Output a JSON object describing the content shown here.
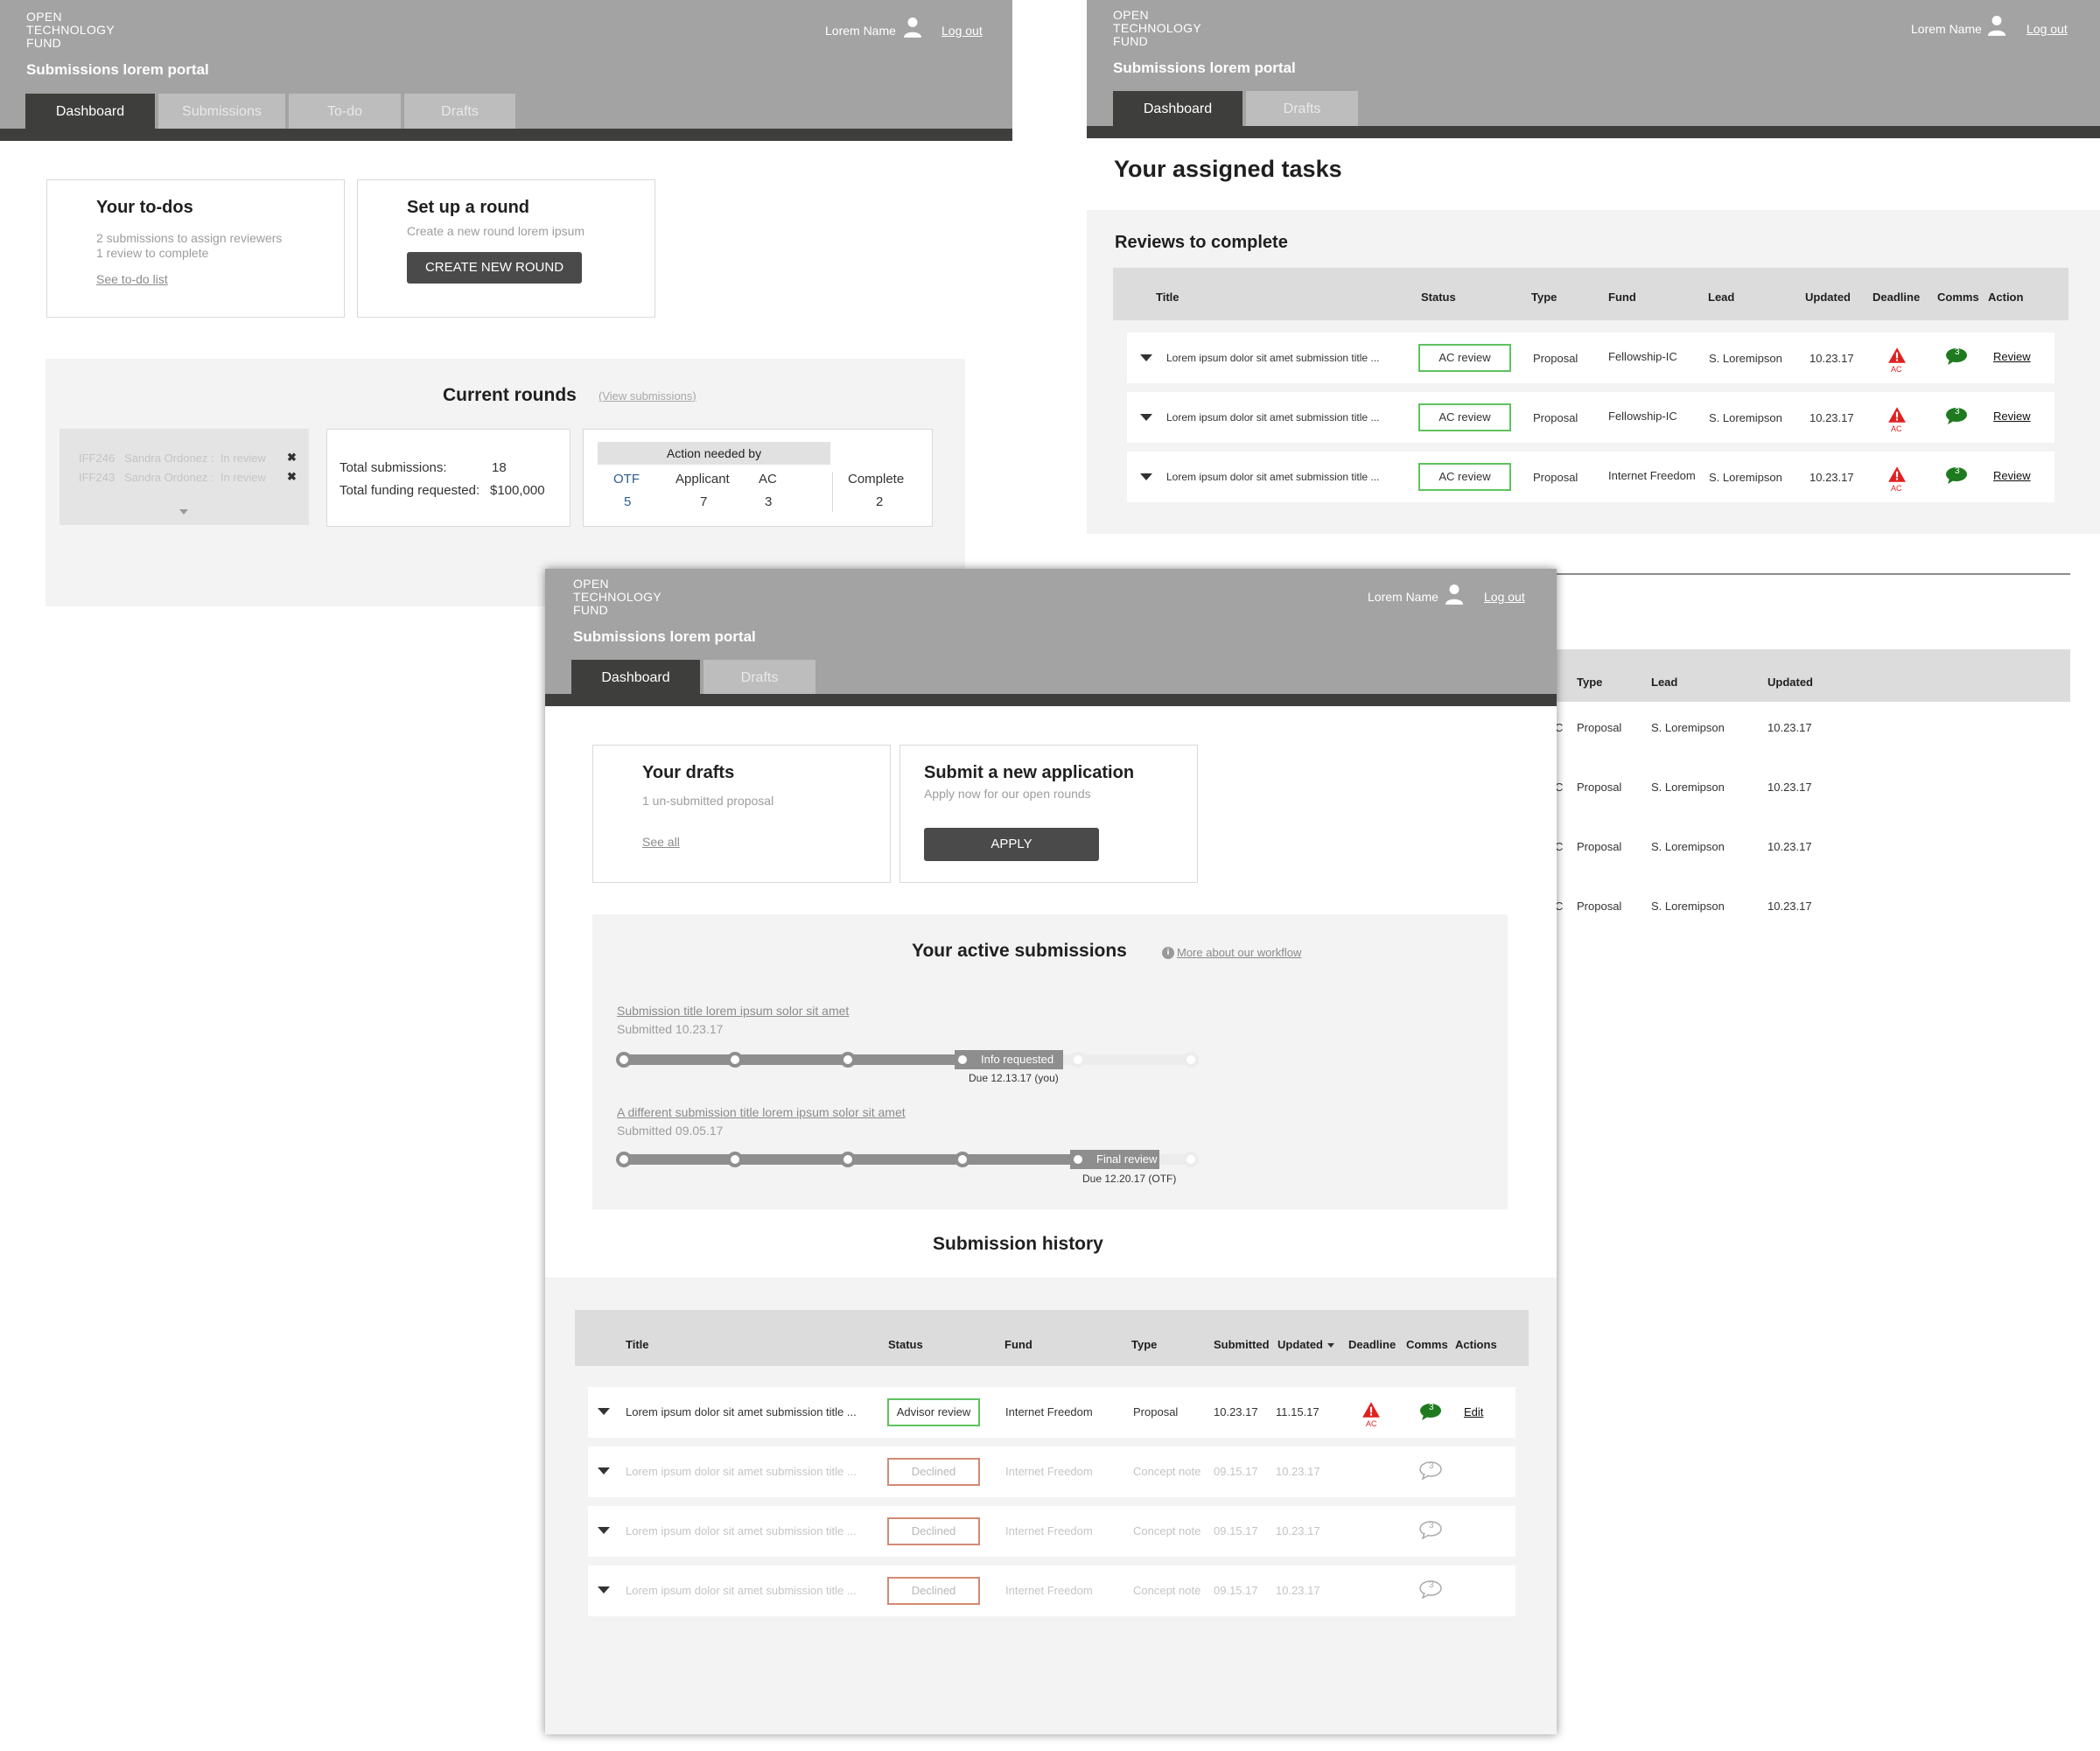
{
  "org_logo": [
    "OPEN",
    "TECHNOLOGY",
    "FUND"
  ],
  "portal_title": "Submissions lorem portal",
  "user_name": "Lorem Name",
  "logout_label": "Log out",
  "admin": {
    "tabs": [
      "Dashboard",
      "Submissions",
      "To-do",
      "Drafts"
    ],
    "todos": {
      "title": "Your to-dos",
      "line1": "2 submissions to assign reviewers",
      "line2": "1 review to complete",
      "link": "See to-do list"
    },
    "round": {
      "title": "Set up a round",
      "subtitle": "Create a new round lorem ipsum",
      "button": "CREATE NEW ROUND"
    },
    "current_rounds": {
      "title": "Current rounds",
      "view_link": "(View submissions)",
      "items": [
        {
          "id": "IFF246",
          "name": "Sandra Ordonez",
          "status": "In review"
        },
        {
          "id": "IFF243",
          "name": "Sandra Ordonez",
          "status": "In review"
        }
      ],
      "total_label": "Total submissions:",
      "total_value": "18",
      "funding_label": "Total funding requested:",
      "funding_value": "$100,000",
      "action_header": "Action needed by",
      "cols": [
        {
          "label": "OTF",
          "value": "5"
        },
        {
          "label": "Applicant",
          "value": "7"
        },
        {
          "label": "AC",
          "value": "3"
        }
      ],
      "complete_label": "Complete",
      "complete_value": "2"
    }
  },
  "reviewer": {
    "tabs": [
      "Dashboard",
      "Drafts"
    ],
    "page_title": "Your assigned tasks",
    "section_title": "Reviews to complete",
    "columns": [
      "Title",
      "Status",
      "Type",
      "Fund",
      "Lead",
      "Updated",
      "Deadline",
      "Comms",
      "Action"
    ],
    "rows": [
      {
        "title": "Lorem ipsum dolor sit amet submission title ...",
        "status": "AC review",
        "type": "Proposal",
        "fund": "Fellowship-IC",
        "lead": "S. Loremipson",
        "updated": "10.23.17",
        "deadline": "AC",
        "comms": "3",
        "action": "Review"
      },
      {
        "title": "Lorem ipsum dolor sit amet submission title ...",
        "status": "AC review",
        "type": "Proposal",
        "fund": "Fellowship-IC",
        "lead": "S. Loremipson",
        "updated": "10.23.17",
        "deadline": "AC",
        "comms": "3",
        "action": "Review"
      },
      {
        "title": "Lorem ipsum dolor sit amet submission title ...",
        "status": "AC review",
        "type": "Proposal",
        "fund": "Internet Freedom",
        "lead": "S. Loremipson",
        "updated": "10.23.17",
        "deadline": "AC",
        "comms": "3",
        "action": "Review"
      }
    ],
    "partial_columns": [
      "Type",
      "Lead",
      "Updated"
    ],
    "partial_rows": [
      {
        "prefix": "C",
        "type": "Proposal",
        "lead": "S. Loremipson",
        "updated": "10.23.17"
      },
      {
        "prefix": "C",
        "type": "Proposal",
        "lead": "S. Loremipson",
        "updated": "10.23.17"
      },
      {
        "prefix": "C",
        "type": "Proposal",
        "lead": "S. Loremipson",
        "updated": "10.23.17"
      },
      {
        "prefix": "C",
        "type": "Proposal",
        "lead": "S. Loremipson",
        "updated": "10.23.17"
      }
    ]
  },
  "applicant": {
    "tabs": [
      "Dashboard",
      "Drafts"
    ],
    "drafts": {
      "title": "Your drafts",
      "line": "1 un-submitted proposal",
      "link": "See all"
    },
    "apply": {
      "title": "Submit a new application",
      "subtitle": "Apply now for our open rounds",
      "button": "APPLY"
    },
    "active": {
      "title": "Your active submissions",
      "more_link": "More about our workflow",
      "submissions": [
        {
          "title": "Submission title lorem ipsum solor sit amet",
          "submitted": "Submitted 10.23.17",
          "stage_label": "Info requested",
          "due": "Due 12.13.17 (you)",
          "progress": 0.6
        },
        {
          "title": "A different submission title lorem ipsum solor sit amet",
          "submitted": "Submitted 09.05.17",
          "stage_label": "Final review",
          "due": "Due 12.20.17 (OTF)",
          "progress": 0.9
        }
      ]
    },
    "history": {
      "title": "Submission history",
      "columns": [
        "Title",
        "Status",
        "Fund",
        "Type",
        "Submitted",
        "Updated",
        "Deadline",
        "Comms",
        "Actions"
      ],
      "rows": [
        {
          "title": "Lorem ipsum dolor sit amet submission title ...",
          "status": "Advisor review",
          "fund": "Internet Freedom",
          "type": "Proposal",
          "submitted": "10.23.17",
          "updated": "11.15.17",
          "deadline": "AC",
          "comms": "3",
          "action": "Edit"
        },
        {
          "title": "Lorem ipsum dolor sit amet submission title ...",
          "status": "Declined",
          "fund": "Internet Freedom",
          "type": "Concept note",
          "submitted": "09.15.17",
          "updated": "10.23.17",
          "comms": "3"
        },
        {
          "title": "Lorem ipsum dolor sit amet submission title ...",
          "status": "Declined",
          "fund": "Internet Freedom",
          "type": "Concept note",
          "submitted": "09.15.17",
          "updated": "10.23.17",
          "comms": "3"
        },
        {
          "title": "Lorem ipsum dolor sit amet submission title ...",
          "status": "Declined",
          "fund": "Internet Freedom",
          "type": "Concept note",
          "submitted": "09.15.17",
          "updated": "10.23.17",
          "comms": "3"
        }
      ]
    }
  },
  "colors": {
    "header_gray": "#a3a3a3",
    "dark_bar": "#3e3e3c",
    "ok_green": "#5fc25f",
    "declined_red": "#d48a73",
    "alert_red": "#e02020",
    "comms_green": "#1e7a1e"
  }
}
